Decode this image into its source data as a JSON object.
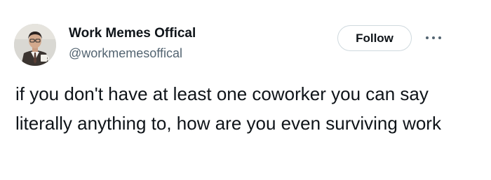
{
  "author": {
    "display_name": "Work Memes Offical",
    "handle": "@workmemesoffical",
    "avatar_icon": "person-photo-icon"
  },
  "actions": {
    "follow_label": "Follow",
    "more_icon": "more-options-icon"
  },
  "tweet": {
    "text": "if you don't have at least one coworker you can say literally anything to, how are you even surviving work"
  },
  "colors": {
    "primary_text": "#0f1419",
    "secondary_text": "#536471",
    "border": "#cfd9de",
    "background": "#ffffff"
  }
}
